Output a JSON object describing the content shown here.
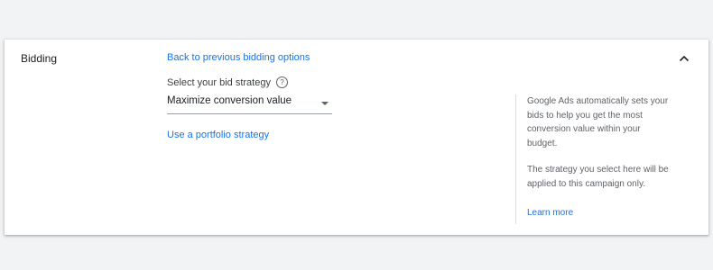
{
  "section": {
    "title": "Bidding",
    "collapse_icon": "chevron-up-icon"
  },
  "bidding": {
    "back_link": "Back to previous bidding options",
    "strategy_label": "Select your bid strategy",
    "help_icon": "help-circle-icon",
    "selected_strategy": "Maximize conversion value",
    "portfolio_link": "Use a portfolio strategy"
  },
  "info_panel": {
    "paragraph_1": "Google Ads automatically sets your bids to help you get the most conversion value within your budget.",
    "paragraph_2": "The strategy you select here will be applied to this campaign only.",
    "learn_more": "Learn more"
  },
  "colors": {
    "background": "#f1f3f4",
    "card": "#ffffff",
    "link": "#1a73e8",
    "text_primary": "#202124",
    "text_secondary": "#5f6368",
    "divider": "#dadce0"
  }
}
